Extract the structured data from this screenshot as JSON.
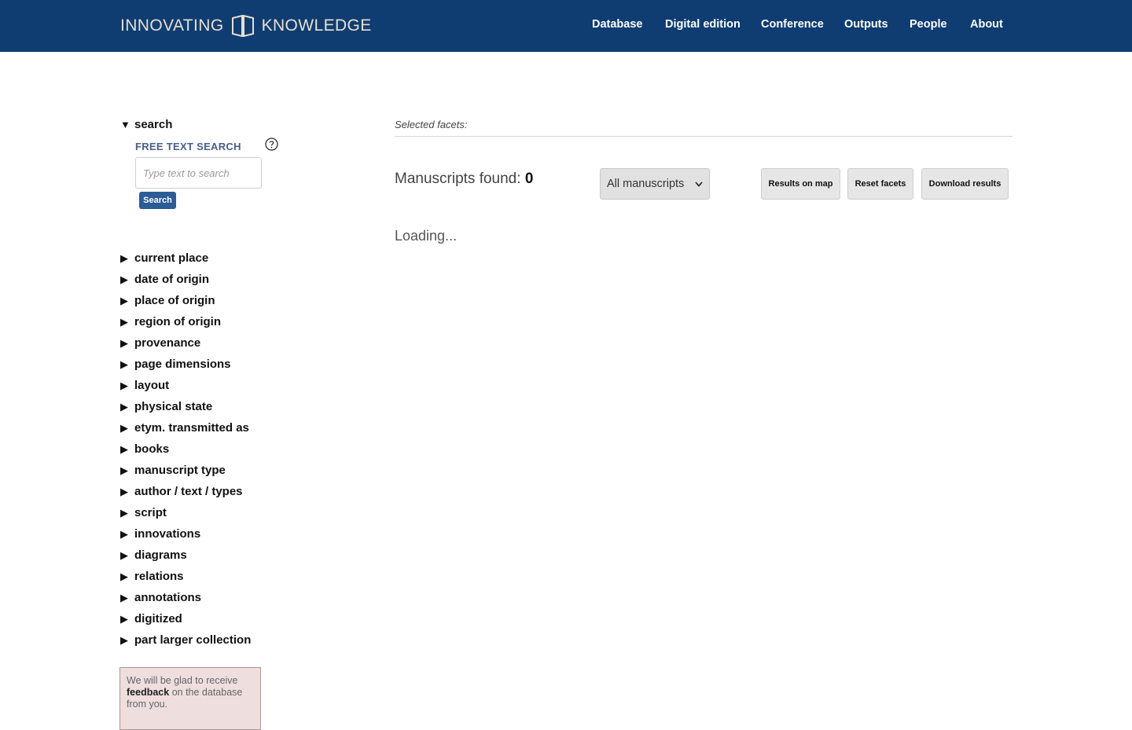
{
  "header": {
    "logo_left": "INNOVATING",
    "logo_right": "KNOWLEDGE",
    "nav": [
      "Database",
      "Digital edition",
      "Conference",
      "Outputs",
      "People",
      "About"
    ],
    "bg_color": "#0f3d72"
  },
  "sidebar": {
    "search_heading": "search",
    "free_text_title": "FREE TEXT SEARCH",
    "search_placeholder": "Type text to search",
    "search_button": "Search",
    "facets": [
      "current place",
      "date of origin",
      "place of origin",
      "region of origin",
      "provenance",
      "page dimensions",
      "layout",
      "physical state",
      "etym. transmitted as",
      "books",
      "manuscript type",
      "author / text / types",
      "script",
      "innovations",
      "diagrams",
      "relations",
      "annotations",
      "digitized",
      "part larger collection"
    ],
    "feedback": {
      "before": "We will be glad to receive",
      "bold": "feedback",
      "after": "on the database from you."
    }
  },
  "main": {
    "selected_facets_label": "Selected facets:",
    "found_label": "Manuscripts found:",
    "found_count": "0",
    "filter_selected": "All manuscripts",
    "buttons": [
      "Results on map",
      "Reset facets",
      "Download results"
    ],
    "loading_text": "Loading..."
  }
}
